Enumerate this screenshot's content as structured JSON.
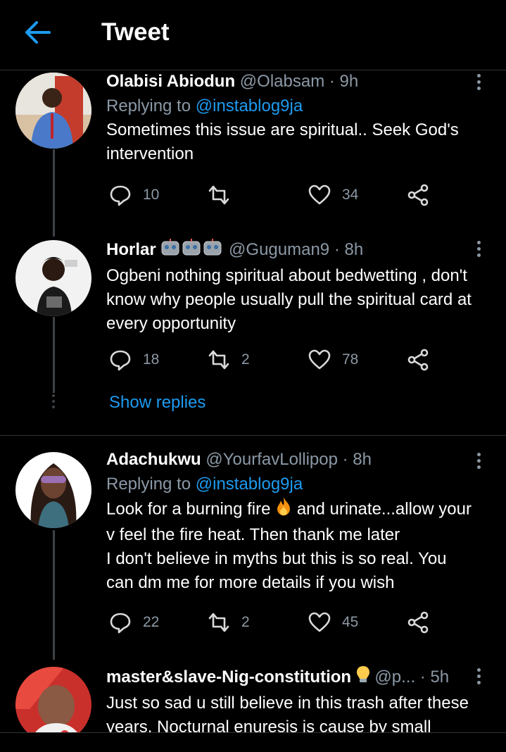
{
  "header": {
    "title": "Tweet"
  },
  "tweets": [
    {
      "name": "Olabisi Abiodun",
      "handle": "@Olabsam",
      "time": "· 9h",
      "replying_prefix": "Replying to ",
      "replying_to": "@instablog9ja",
      "text_lines": [
        "Sometimes this issue are spiritual.. Seek God's",
        "intervention"
      ],
      "replies": "10",
      "retweets": "",
      "likes": "34"
    },
    {
      "name": "Horlar",
      "handle": "@Guguman9",
      "time": "· 8h",
      "text_lines": [
        "Ogbeni nothing spiritual about bedwetting , don't",
        "know why people usually pull the spiritual card at",
        "every opportunity"
      ],
      "replies": "18",
      "retweets": "2",
      "likes": "78"
    },
    {
      "name": "Adachukwu",
      "handle": "@YourfavLollipop",
      "time": "· 8h",
      "replying_prefix": "Replying to ",
      "replying_to": "@instablog9ja",
      "text_lines": [
        "Look for a burning fire",
        "and urinate...allow your",
        "v feel the fire heat. Then thank me later",
        "I don't believe in myths but this is so real. You",
        "can dm me for more details if you wish"
      ],
      "replies": "22",
      "retweets": "2",
      "likes": "45"
    },
    {
      "name": "master&slave-Nig-constitution",
      "handle": "@p...",
      "time": "· 5h",
      "text_lines": [
        "Just so sad u still believe in this trash after these",
        "years. Nocturnal enuresis is cause by small"
      ]
    }
  ],
  "show_replies": "Show replies",
  "colors": {
    "accent": "#1d9bf0",
    "muted": "#8b98a5",
    "background": "#000000"
  }
}
